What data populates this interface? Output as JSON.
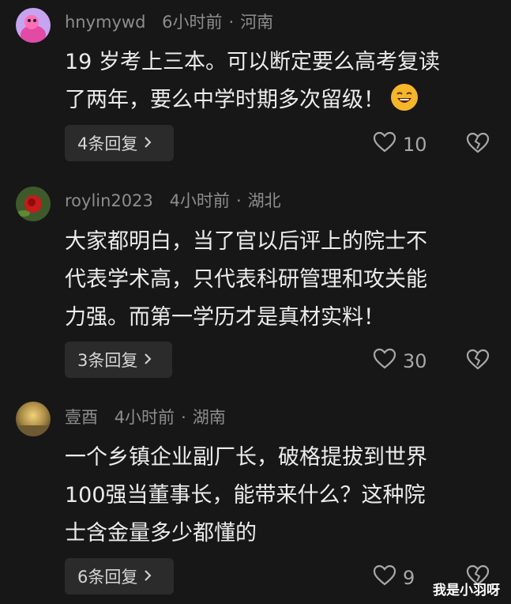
{
  "comments": [
    {
      "username": "hnymywd",
      "time": "6小时前",
      "location": "河南",
      "text_lines": [
        "19 岁考上三本。可以断定要么高考复读",
        "了两年，要么中学时期多次留级！"
      ],
      "replies": "4条回复",
      "likes": "10"
    },
    {
      "username": "roylin2023",
      "time": "4小时前",
      "location": "湖北",
      "text_lines": [
        "大家都明白，当了官以后评上的院士不",
        "代表学术高，只代表科研管理和攻关能",
        "力强。而第一学历才是真材实料！"
      ],
      "replies": "3条回复",
      "likes": "30"
    },
    {
      "username": "壹酉",
      "time": "4小时前",
      "location": "湖南",
      "text_lines": [
        "一个乡镇企业副厂长，破格提拔到世界",
        "100强当董事长，能带来什么？这种院",
        "士含金量多少都懂的"
      ],
      "replies": "6条回复",
      "likes": "9"
    }
  ],
  "separator": "·",
  "watermark": "我是小羽呀",
  "icons": {
    "like": "heart-outline-icon",
    "dislike": "broken-heart-icon",
    "chevron": "chevron-right-icon",
    "emoji": "laughing-emoji-icon"
  }
}
